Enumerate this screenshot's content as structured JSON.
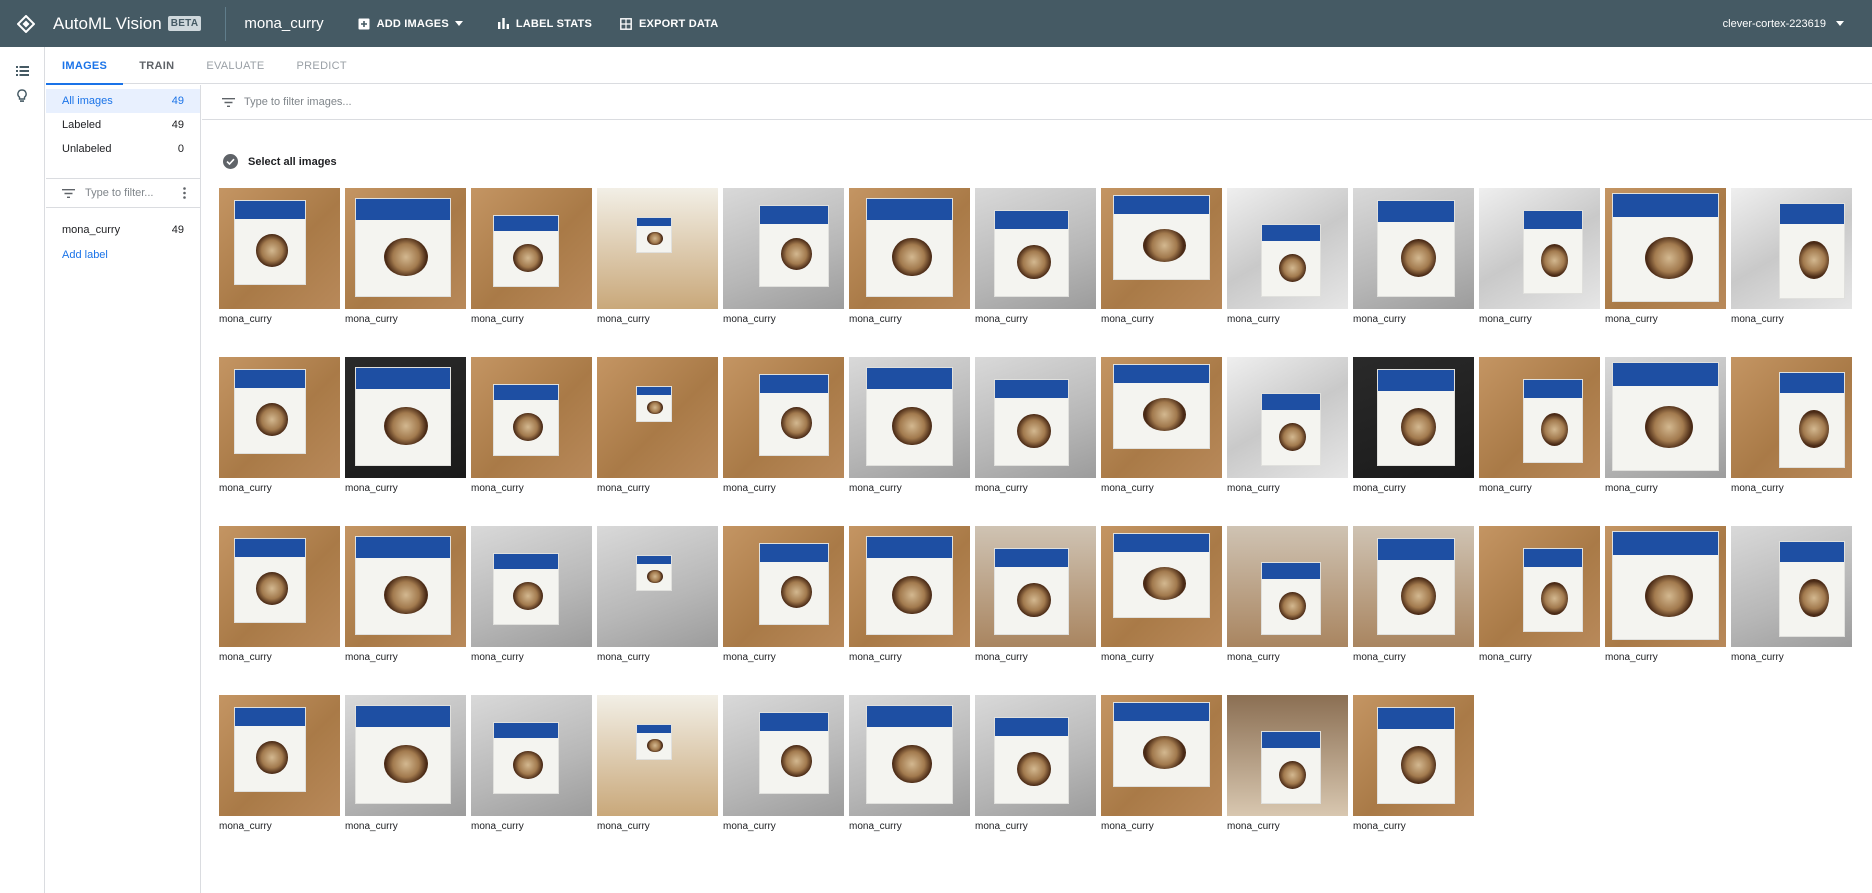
{
  "topbar": {
    "app_title": "AutoML Vision",
    "beta_badge": "BETA",
    "dataset_name": "mona_curry",
    "add_images": "ADD IMAGES",
    "label_stats": "LABEL STATS",
    "export_data": "EXPORT DATA",
    "project": "clever-cortex-223619"
  },
  "tabs": [
    {
      "label": "IMAGES",
      "state": "active"
    },
    {
      "label": "TRAIN",
      "state": "normal"
    },
    {
      "label": "EVALUATE",
      "state": "disabled"
    },
    {
      "label": "PREDICT",
      "state": "disabled"
    }
  ],
  "sidebar": {
    "filters": [
      {
        "label": "All images",
        "count": "49"
      },
      {
        "label": "Labeled",
        "count": "49"
      },
      {
        "label": "Unlabeled",
        "count": "0"
      }
    ],
    "label_filter_placeholder": "Type to filter...",
    "labels": [
      {
        "label": "mona_curry",
        "count": "49"
      }
    ],
    "add_label": "Add label"
  },
  "main": {
    "filter_placeholder": "Type to filter images...",
    "select_all": "Select all images",
    "image_label": "mona_curry",
    "image_count": 49
  },
  "colors": {
    "topbar": "#455a64",
    "accent": "#1a73e8",
    "wood": "#b88a57",
    "white_bg": "#dcdcdc",
    "dark_bg": "#2b2b2b",
    "box_blue": "#1e4fa3"
  },
  "thumbnails": [
    "wood",
    "wood",
    "wood",
    "paper",
    "gray",
    "wood",
    "gray",
    "wood",
    "bag",
    "gray",
    "bag",
    "wood",
    "bag",
    "wood",
    "dark",
    "wood",
    "wood",
    "wood",
    "gray",
    "gray",
    "wood",
    "bag",
    "dark",
    "wood",
    "gray",
    "wood",
    "wood",
    "wood",
    "gray",
    "gray",
    "wood",
    "wood",
    "room",
    "wood",
    "room",
    "room",
    "wood",
    "wood",
    "gray",
    "wood",
    "gray",
    "gray",
    "paper",
    "gray",
    "gray",
    "gray",
    "wood",
    "shelf",
    "wood"
  ]
}
